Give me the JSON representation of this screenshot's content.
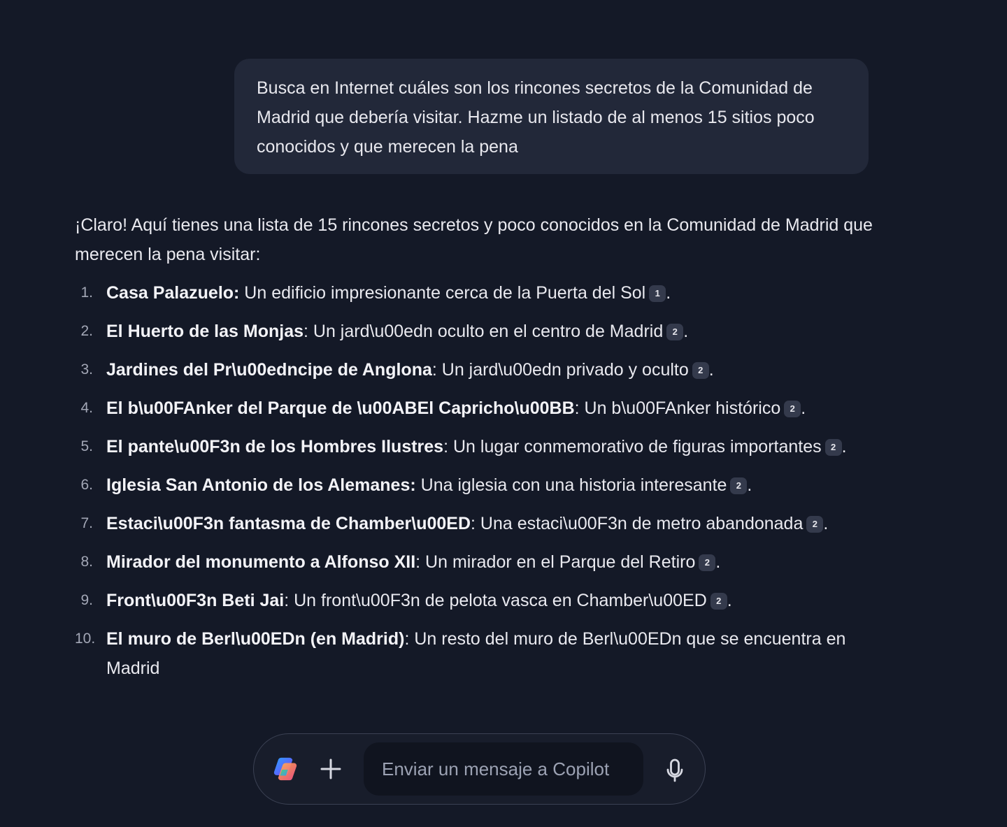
{
  "user_message": {
    "text": "Busca en Internet cuáles son los rincones secretos de la Comunidad de Madrid que debería visitar. Hazme un listado de al menos 15 sitios poco conocidos y que merecen la pena"
  },
  "reply": {
    "intro": "¡Claro! Aquí tienes una lista de 15 rincones secretos y poco conocidos en la Comunidad de Madrid que merecen la pena visitar:",
    "items": [
      {
        "num": "1.",
        "name": "Casa Palazuelo:",
        "desc": " Un edificio impresionante cerca de la Puerta del Sol",
        "cite": "1",
        "end": "."
      },
      {
        "num": "2.",
        "name": "El Huerto de las Monjas",
        "desc": ": Un jard\\u00edn oculto en el centro de Madrid",
        "cite": "2",
        "end": "."
      },
      {
        "num": "3.",
        "name": "Jardines del Pr\\u00edncipe de Anglona",
        "desc": ": Un jard\\u00edn privado y oculto",
        "cite": "2",
        "end": "."
      },
      {
        "num": "4.",
        "name": "El b\\u00FAnker del Parque de \\u00ABEl Capricho\\u00BB",
        "desc": ": Un b\\u00FAnker histórico",
        "cite": "2",
        "end": "."
      },
      {
        "num": "5.",
        "name": "El pante\\u00F3n de los Hombres Ilustres",
        "desc": ": Un lugar conmemorativo de figuras importantes",
        "cite": "2",
        "end": "."
      },
      {
        "num": "6.",
        "name": "Iglesia San Antonio de los Alemanes:",
        "desc": " Una iglesia con una historia interesante",
        "cite": "2",
        "end": "."
      },
      {
        "num": "7.",
        "name": "Estaci\\u00F3n fantasma de Chamber\\u00ED",
        "desc": ": Una estaci\\u00F3n de metro abandonada",
        "cite": "2",
        "end": "."
      },
      {
        "num": "8.",
        "name": "Mirador del monumento a Alfonso XII",
        "desc": ": Un mirador en el Parque del Retiro",
        "cite": "2",
        "end": "."
      },
      {
        "num": "9.",
        "name": "Front\\u00F3n Beti Jai",
        "desc": ": Un front\\u00F3n de pelota vasca en Chamber\\u00ED",
        "cite": "2",
        "end": "."
      },
      {
        "num": "10.",
        "name": "El muro de Berl\\u00EDn (en Madrid)",
        "desc": ": Un resto del muro de Berl\\u00EDn que se encuentra en Madrid",
        "cite": "",
        "end": ""
      }
    ]
  },
  "composer": {
    "placeholder": "Enviar un mensaje a Copilot",
    "icons": {
      "logo": "copilot-logo-icon",
      "add": "plus-icon",
      "mic": "microphone-icon"
    }
  },
  "colors": {
    "background": "#141927",
    "user_bubble": "#222839",
    "composer_border": "#3b4153",
    "text": "#e9e9ef"
  }
}
